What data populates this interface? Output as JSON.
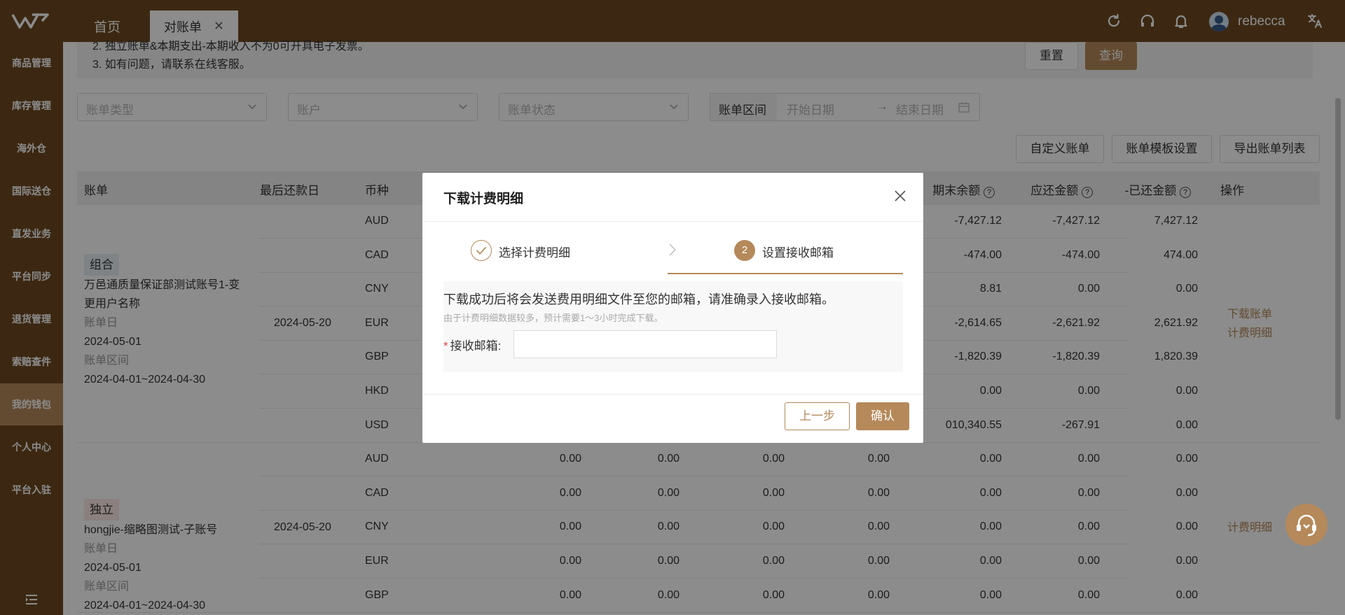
{
  "topbar": {
    "tabs": [
      {
        "label": "首页"
      },
      {
        "label": "对账单"
      }
    ],
    "username": "rebecca"
  },
  "sidebar": {
    "items": [
      {
        "label": "商品管理"
      },
      {
        "label": "库存管理"
      },
      {
        "label": "海外仓"
      },
      {
        "label": "国际送仓"
      },
      {
        "label": "直发业务"
      },
      {
        "label": "平台同步"
      },
      {
        "label": "退货管理"
      },
      {
        "label": "索赔查件"
      },
      {
        "label": "我的钱包"
      },
      {
        "label": "个人中心"
      },
      {
        "label": "平台入驻"
      }
    ],
    "active_index": 8
  },
  "notice": {
    "line1": "2. 独立账单&本期支出-本期收入不为0可开具电子发票。",
    "line2": "3. 如有问题，请联系在线客服。"
  },
  "filters": {
    "bill_type": "账单类型",
    "account": "账户",
    "bill_status": "账单状态",
    "date_label": "账单区间",
    "start_date": "开始日期",
    "end_date": "结束日期",
    "reset": "重置",
    "query": "查询"
  },
  "actions": {
    "custom_bill": "自定义账单",
    "template_settings": "账单模板设置",
    "export_list": "导出账单列表"
  },
  "table": {
    "headers": {
      "bill": "账单",
      "due_date": "最后还款日",
      "currency": "币种",
      "end_balance": "期末余额",
      "payable": "应还金额",
      "paid": "-已还金额",
      "ops": "操作"
    },
    "groups": [
      {
        "badge": "组合",
        "name": "万邑通质量保证部测试账号1-变更用户名称",
        "bill_date_label": "账单日",
        "bill_date": "2024-05-01",
        "range_label": "账单区间",
        "range": "2024-04-01~2024-04-30",
        "due": "2024-05-20",
        "ops": [
          "下载账单",
          "计费明细"
        ],
        "rows": [
          {
            "currency": "AUD",
            "end_balance": "-7,427.12",
            "payable": "-7,427.12",
            "paid": "7,427.12"
          },
          {
            "currency": "CAD",
            "end_balance": "-474.00",
            "payable": "-474.00",
            "paid": "474.00"
          },
          {
            "currency": "CNY",
            "end_balance": "8.81",
            "payable": "0.00",
            "paid": "0.00"
          },
          {
            "currency": "EUR",
            "end_balance": "-2,614.65",
            "payable": "-2,621.92",
            "paid": "2,621.92"
          },
          {
            "currency": "GBP",
            "end_balance": "-1,820.39",
            "payable": "-1,820.39",
            "paid": "1,820.39"
          },
          {
            "currency": "HKD",
            "end_balance": "0.00",
            "payable": "0.00",
            "paid": "0.00"
          },
          {
            "currency": "USD",
            "end_balance": "010,340.55",
            "payable": "-267.91",
            "paid": "0.00"
          }
        ]
      },
      {
        "badge": "独立",
        "name": "hongjie-缩略图测试-子账号",
        "bill_date_label": "账单日",
        "bill_date": "2024-05-01",
        "range_label": "账单区间",
        "range": "2024-04-01~2024-04-30",
        "due": "2024-05-20",
        "ops": [
          "计费明细"
        ],
        "rows": [
          {
            "currency": "AUD",
            "c1": "0.00",
            "c2": "0.00",
            "c3": "0.00",
            "c4": "0.00",
            "end_balance": "0.00",
            "payable": "0.00",
            "paid": "0.00"
          },
          {
            "currency": "CAD",
            "c1": "0.00",
            "c2": "0.00",
            "c3": "0.00",
            "c4": "0.00",
            "end_balance": "0.00",
            "payable": "0.00",
            "paid": "0.00"
          },
          {
            "currency": "CNY",
            "c1": "0.00",
            "c2": "0.00",
            "c3": "0.00",
            "c4": "0.00",
            "end_balance": "0.00",
            "payable": "0.00",
            "paid": "0.00"
          },
          {
            "currency": "EUR",
            "c1": "0.00",
            "c2": "0.00",
            "c3": "0.00",
            "c4": "0.00",
            "end_balance": "0.00",
            "payable": "0.00",
            "paid": "0.00"
          },
          {
            "currency": "GBP",
            "c1": "0.00",
            "c2": "0.00",
            "c3": "0.00",
            "c4": "0.00",
            "end_balance": "0.00",
            "payable": "0.00",
            "paid": "0.00"
          }
        ]
      }
    ]
  },
  "modal": {
    "title": "下载计费明细",
    "step1": "选择计费明细",
    "step2_num": "2",
    "step2": "设置接收邮箱",
    "info_main": "下载成功后将会发送费用明细文件至您的邮箱，请准确录入接收邮箱。",
    "info_sub": "由于计费明细数据较多，预计需要1～3小时完成下载。",
    "email_required": "*",
    "email_label": "接收邮箱:",
    "email_value": "",
    "prev": "上一步",
    "confirm": "确认"
  },
  "colors": {
    "brand": "#6e4a22",
    "accent": "#b5895a"
  }
}
